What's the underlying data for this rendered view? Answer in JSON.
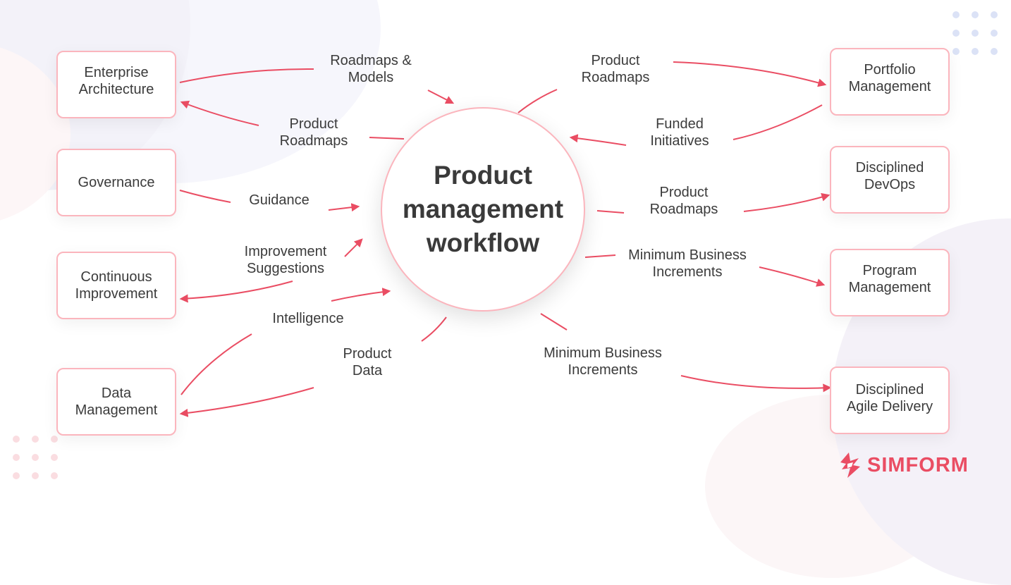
{
  "title": "Product management workflow",
  "center": {
    "label": "Product management workflow"
  },
  "nodes": {
    "enterprise_architecture": "Enterprise Architecture",
    "governance": "Governance",
    "continuous_improvement": "Continuous Improvement",
    "data_management": "Data Management",
    "portfolio_management": "Portfolio Management",
    "disciplined_devops": "Disciplined DevOps",
    "program_management": "Program Management",
    "disciplined_agile_delivery": "Disciplined Agile Delivery"
  },
  "edges": [
    {
      "id": "e1",
      "label": "Roadmaps & Models",
      "from": "Enterprise Architecture",
      "to": "Product management workflow"
    },
    {
      "id": "e2",
      "label": "Product Roadmaps",
      "from": "Product management workflow",
      "to": "Enterprise Architecture"
    },
    {
      "id": "e3",
      "label": "Guidance",
      "from": "Governance",
      "to": "Product management workflow"
    },
    {
      "id": "e4",
      "label": "Improvement Suggestions",
      "from": "Continuous Improvement",
      "to": "Product management workflow"
    },
    {
      "id": "e5",
      "label": "Intelligence",
      "from": "Data Management",
      "to": "Product management workflow"
    },
    {
      "id": "e6",
      "label": "Product Data",
      "from": "Product management workflow",
      "to": "Data Management"
    },
    {
      "id": "e7",
      "label": "Product Roadmaps",
      "from": "Product management workflow",
      "to": "Portfolio Management"
    },
    {
      "id": "e8",
      "label": "Funded Initiatives",
      "from": "Portfolio Management",
      "to": "Product management workflow"
    },
    {
      "id": "e9",
      "label": "Product Roadmaps",
      "from": "Product management workflow",
      "to": "Disciplined DevOps"
    },
    {
      "id": "e10",
      "label": "Minimum Business Increments",
      "from": "Product management workflow",
      "to": "Program Management"
    },
    {
      "id": "e11",
      "label": "Minimum Business Increments",
      "from": "Product management workflow",
      "to": "Disciplined Agile Delivery"
    }
  ],
  "labels": {
    "roadmaps_models": [
      "Roadmaps &",
      "Models"
    ],
    "product_roadmaps_left": [
      "Product",
      "Roadmaps"
    ],
    "guidance": [
      "Guidance"
    ],
    "improvement_suggestions": [
      "Improvement",
      "Suggestions"
    ],
    "intelligence": [
      "Intelligence"
    ],
    "product_data": [
      "Product",
      "Data"
    ],
    "product_roadmaps_top": [
      "Product",
      "Roadmaps"
    ],
    "funded_initiatives": [
      "Funded",
      "Initiatives"
    ],
    "product_roadmaps_mid": [
      "Product",
      "Roadmaps"
    ],
    "mbi_right": [
      "Minimum Business",
      "Increments"
    ],
    "mbi_bottom": [
      "Minimum Business",
      "Increments"
    ]
  },
  "brand": {
    "name": "SIMFORM",
    "accent_color": "#ea4d63",
    "border_color": "#fbb5bd"
  }
}
